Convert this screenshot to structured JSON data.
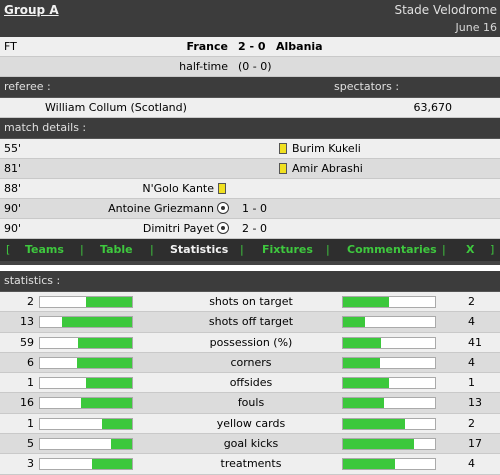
{
  "header": {
    "group": "Group A",
    "venue": "Stade Velodrome",
    "date": "June 16"
  },
  "match": {
    "status": "FT",
    "home": "France",
    "score": "2 - 0",
    "away": "Albania",
    "halftime_label": "half-time",
    "halftime_score": "(0 - 0)"
  },
  "referee": {
    "label": "referee :",
    "name": "William Collum (Scotland)"
  },
  "spectators": {
    "label": "spectators :",
    "count": "63,670"
  },
  "details": {
    "label": "match details :",
    "events": [
      {
        "minute": "55'",
        "player": "Burim Kukeli",
        "side": "away",
        "type": "yellow-card",
        "score": ""
      },
      {
        "minute": "81'",
        "player": "Amir Abrashi",
        "side": "away",
        "type": "yellow-card",
        "score": ""
      },
      {
        "minute": "88'",
        "player": "N'Golo Kante",
        "side": "home",
        "type": "yellow-card",
        "score": ""
      },
      {
        "minute": "90'",
        "player": "Antoine Griezmann",
        "side": "home",
        "type": "goal",
        "score": "1 - 0"
      },
      {
        "minute": "90'",
        "player": "Dimitri Payet",
        "side": "home",
        "type": "goal",
        "score": "2 - 0"
      }
    ]
  },
  "tabs": [
    {
      "label": "Teams",
      "active": false
    },
    {
      "label": "Table",
      "active": false
    },
    {
      "label": "Statistics",
      "active": true
    },
    {
      "label": "Fixtures",
      "active": false
    },
    {
      "label": "Commentaries",
      "active": false
    },
    {
      "label": "X",
      "active": false
    }
  ],
  "brackets": {
    "open": "[",
    "sep": "|",
    "close": "]"
  },
  "statistics": {
    "label": "statistics :",
    "rows": [
      {
        "name": "shots on target",
        "home": "2",
        "away": "2",
        "home_share": 0.5,
        "away_share": 0.5
      },
      {
        "name": "shots off target",
        "home": "13",
        "away": "4",
        "home_share": 0.76,
        "away_share": 0.24
      },
      {
        "name": "possession (%)",
        "home": "59",
        "away": "41",
        "home_share": 0.59,
        "away_share": 0.41
      },
      {
        "name": "corners",
        "home": "6",
        "away": "4",
        "home_share": 0.6,
        "away_share": 0.4
      },
      {
        "name": "offsides",
        "home": "1",
        "away": "1",
        "home_share": 0.5,
        "away_share": 0.5
      },
      {
        "name": "fouls",
        "home": "16",
        "away": "13",
        "home_share": 0.55,
        "away_share": 0.45
      },
      {
        "name": "yellow cards",
        "home": "1",
        "away": "2",
        "home_share": 0.33,
        "away_share": 0.67
      },
      {
        "name": "goal kicks",
        "home": "5",
        "away": "17",
        "home_share": 0.23,
        "away_share": 0.77
      },
      {
        "name": "treatments",
        "home": "3",
        "away": "4",
        "home_share": 0.43,
        "away_share": 0.57
      }
    ]
  },
  "colors": {
    "accent": "#3cc83c",
    "dark": "#3c3c3c",
    "card": "#f0e020"
  }
}
